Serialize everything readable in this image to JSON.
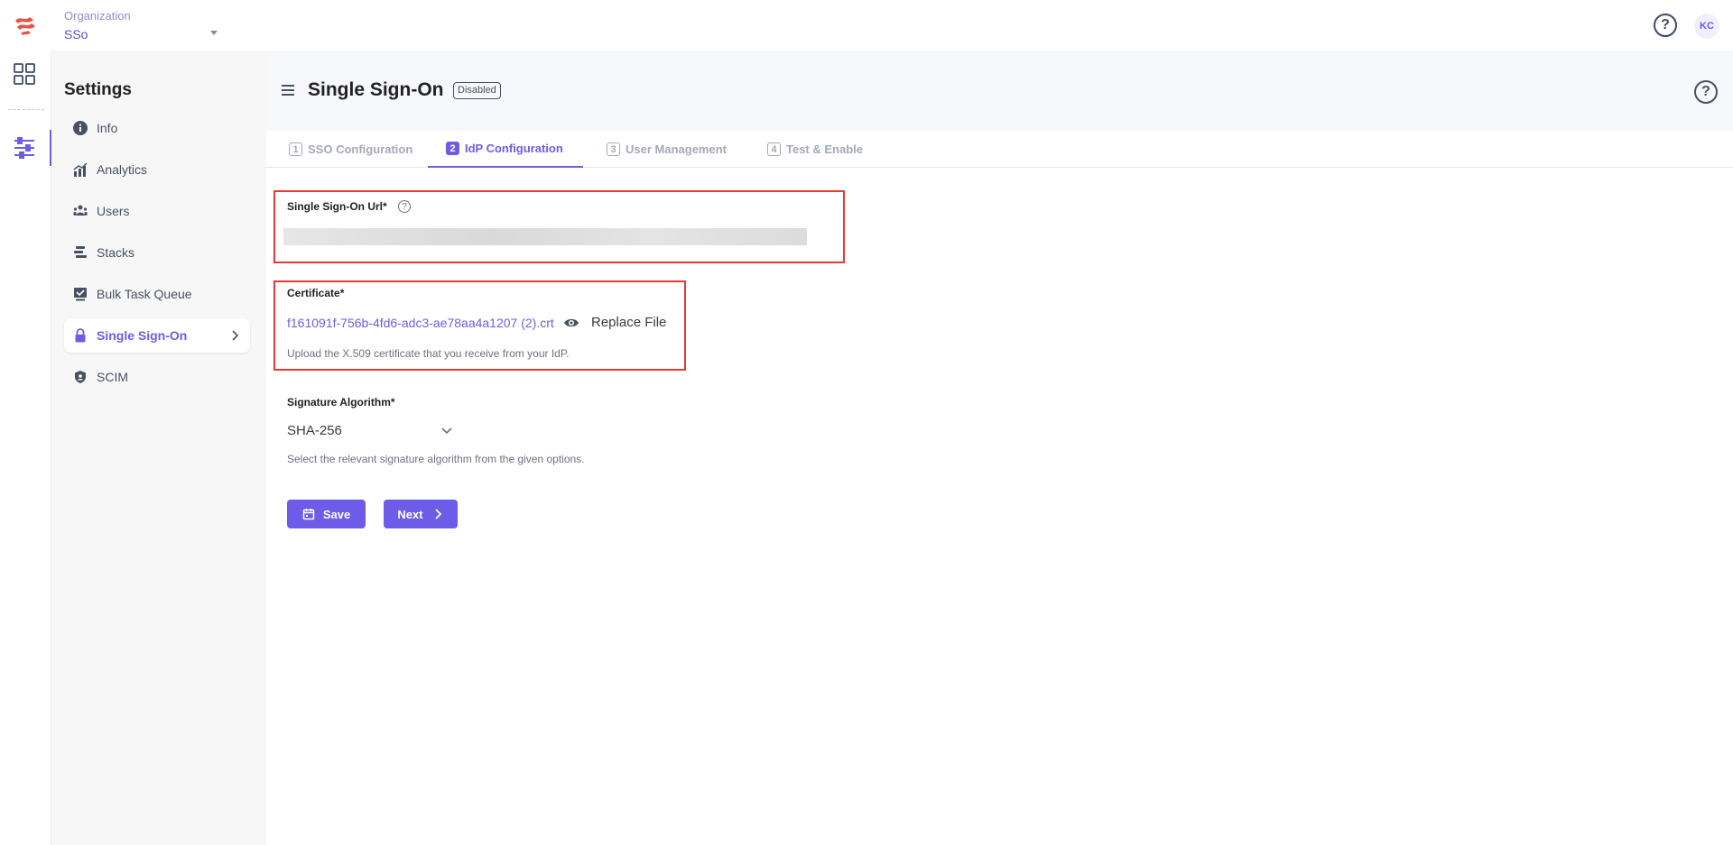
{
  "org": {
    "label": "Organization",
    "value": "SSo"
  },
  "user": {
    "initials": "KC"
  },
  "icons": {
    "help": "?"
  },
  "sidebar": {
    "title": "Settings",
    "items": [
      {
        "label": "Info",
        "icon": "info-icon"
      },
      {
        "label": "Analytics",
        "icon": "analytics-icon"
      },
      {
        "label": "Users",
        "icon": "users-icon"
      },
      {
        "label": "Stacks",
        "icon": "stacks-icon"
      },
      {
        "label": "Bulk Task Queue",
        "icon": "bulk-task-icon"
      },
      {
        "label": "Single Sign-On",
        "icon": "lock-icon",
        "active": true
      },
      {
        "label": "SCIM",
        "icon": "shield-icon"
      }
    ]
  },
  "header": {
    "title": "Single Sign-On",
    "status": "Disabled"
  },
  "tabs": [
    {
      "num": "1",
      "label": "SSO Configuration"
    },
    {
      "num": "2",
      "label": "IdP Configuration",
      "active": true
    },
    {
      "num": "3",
      "label": "User Management"
    },
    {
      "num": "4",
      "label": "Test & Enable"
    }
  ],
  "form": {
    "sso_url": {
      "label": "Single Sign-On Url*",
      "value": ""
    },
    "certificate": {
      "label": "Certificate*",
      "file_name": "f161091f-756b-4fd6-adc3-ae78aa4a1207 (2).crt",
      "replace_label": "Replace File",
      "help": "Upload the X.509 certificate that you receive from your IdP."
    },
    "signature": {
      "label": "Signature Algorithm*",
      "value": "SHA-256",
      "help": "Select the relevant signature algorithm from the given options."
    }
  },
  "actions": {
    "save_label": "Save",
    "next_label": "Next"
  },
  "colors": {
    "accent": "#6c5ce7",
    "highlight": "#e53935",
    "logo": "#e8534a"
  }
}
